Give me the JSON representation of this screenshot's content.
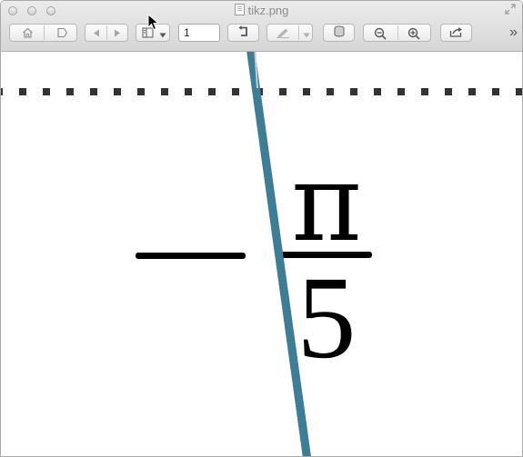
{
  "window": {
    "title": "tikz.png"
  },
  "toolbar": {
    "page_number": "1",
    "overflow_label": "»"
  },
  "figure": {
    "numerator": "π",
    "denominator": "5",
    "line_color": "#3d7e96",
    "dot_color": "#333333"
  }
}
